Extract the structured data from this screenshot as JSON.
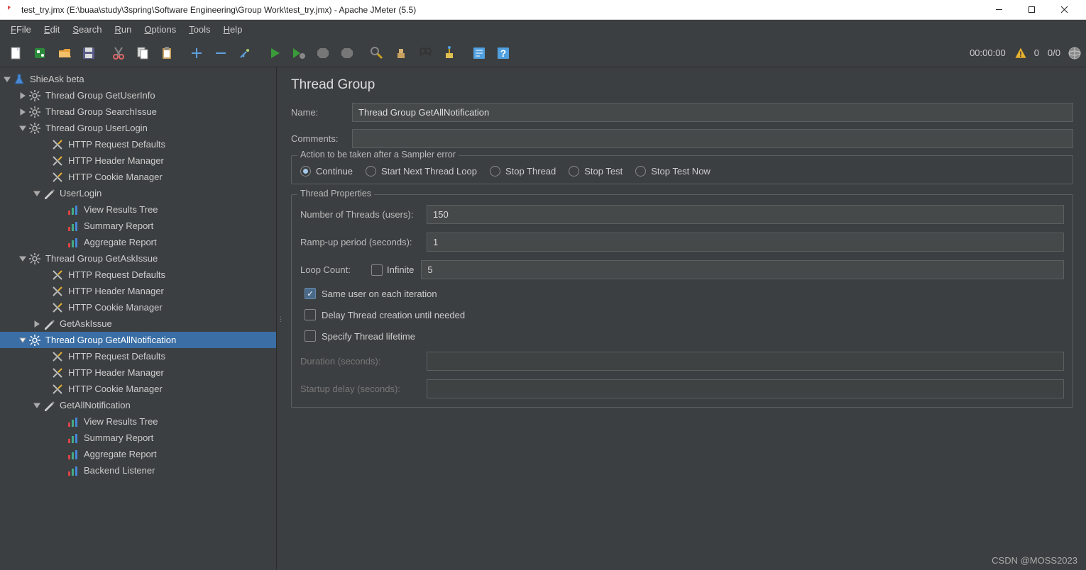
{
  "window": {
    "title": "test_try.jmx (E:\\buaa\\study\\3spring\\Software Engineering\\Group Work\\test_try.jmx) - Apache JMeter (5.5)"
  },
  "menubar": [
    "File",
    "Edit",
    "Search",
    "Run",
    "Options",
    "Tools",
    "Help"
  ],
  "toolbar": {
    "time": "00:00:00",
    "warn_count": "0",
    "ratio": "0/0"
  },
  "tree": {
    "root": "ShieAsk beta",
    "tg_getuserinfo": "Thread Group GetUserInfo",
    "tg_searchissue": "Thread Group SearchIssue",
    "tg_userlogin": "Thread Group UserLogin",
    "http_defaults": "HTTP Request Defaults",
    "http_header": "HTTP Header Manager",
    "http_cookie": "HTTP Cookie Manager",
    "userlogin": "UserLogin",
    "view_results": "View Results Tree",
    "summary_report": "Summary Report",
    "aggregate_report": "Aggregate Report",
    "tg_getaskissue": "Thread Group GetAskIssue",
    "getaskissue": "GetAskIssue",
    "tg_getallnotif": "Thread Group GetAllNotification",
    "getallnotif": "GetAllNotification",
    "backend_listener": "Backend Listener"
  },
  "content": {
    "title": "Thread Group",
    "name_label": "Name:",
    "name_value": "Thread Group GetAllNotification",
    "comments_label": "Comments:",
    "comments_value": "",
    "sampler_error_legend": "Action to be taken after a Sampler error",
    "radio_continue": "Continue",
    "radio_start_next": "Start Next Thread Loop",
    "radio_stop_thread": "Stop Thread",
    "radio_stop_test": "Stop Test",
    "radio_stop_now": "Stop Test Now",
    "thread_props_legend": "Thread Properties",
    "num_threads_label": "Number of Threads (users):",
    "num_threads_value": "150",
    "rampup_label": "Ramp-up period (seconds):",
    "rampup_value": "1",
    "loop_label": "Loop Count:",
    "loop_infinite": "Infinite",
    "loop_value": "5",
    "same_user": "Same user on each iteration",
    "delay_thread": "Delay Thread creation until needed",
    "specify_lifetime": "Specify Thread lifetime",
    "duration_label": "Duration (seconds):",
    "duration_value": "",
    "startup_label": "Startup delay (seconds):",
    "startup_value": ""
  },
  "watermark": "CSDN @MOSS2023"
}
